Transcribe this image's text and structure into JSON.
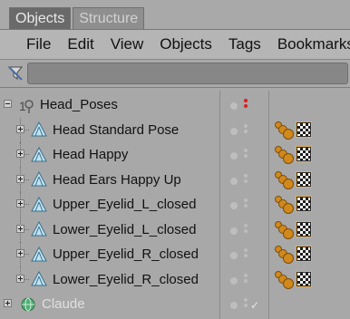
{
  "tabs": [
    {
      "label": "Objects"
    },
    {
      "label": "Structure"
    }
  ],
  "menu": [
    "File",
    "Edit",
    "View",
    "Objects",
    "Tags",
    "Bookmarks"
  ],
  "objects": [
    {
      "name": "Head_Poses",
      "type": "null-group",
      "expander": "minus",
      "level": 0
    },
    {
      "name": "Head Standard Pose",
      "type": "pose-object",
      "expander": "plus",
      "level": 1
    },
    {
      "name": "Head Happy",
      "type": "pose-object",
      "expander": "plus",
      "level": 1
    },
    {
      "name": "Head Ears Happy Up",
      "type": "pose-object",
      "expander": "plus",
      "level": 1
    },
    {
      "name": "Upper_Eyelid_L_closed",
      "type": "pose-object",
      "expander": "plus",
      "level": 1
    },
    {
      "name": "Lower_Eyelid_L_closed",
      "type": "pose-object",
      "expander": "plus",
      "level": 1
    },
    {
      "name": "Upper_Eyelid_R_closed",
      "type": "pose-object",
      "expander": "plus",
      "level": 1
    },
    {
      "name": "Lower_Eyelid_R_closed",
      "type": "pose-object",
      "expander": "plus",
      "level": 1
    },
    {
      "name": "Claude",
      "type": "sphere-object",
      "expander": "plus",
      "level": 0
    }
  ],
  "colors": {
    "active_tab": "#6a6a6a",
    "red_dots": "#e01b1b",
    "morph_tag": "#d1891b"
  }
}
